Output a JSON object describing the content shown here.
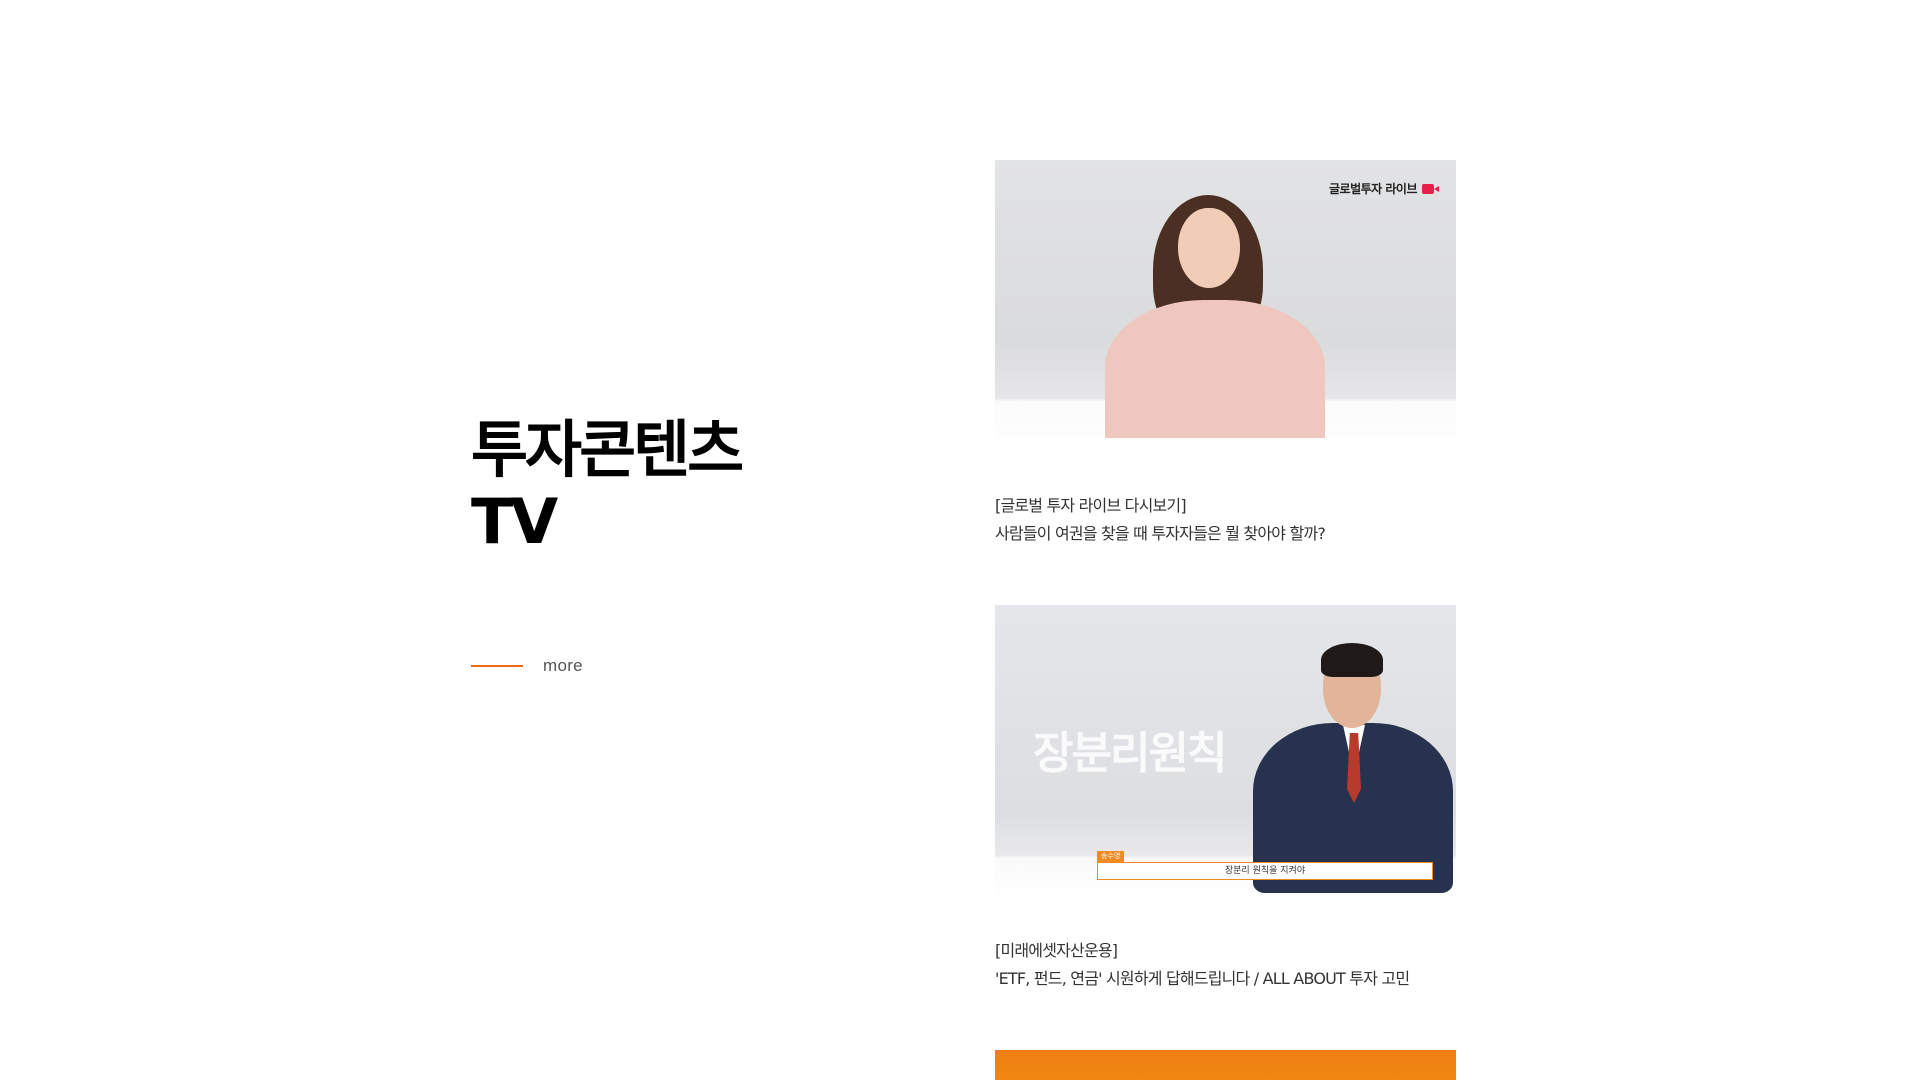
{
  "section": {
    "title_line1": "투자콘텐츠",
    "title_line2": "TV",
    "more_label": "more",
    "accent_color": "#ee6a15"
  },
  "videos": [
    {
      "thumbnail_badge": "글로벌투자 라이브",
      "category": "[글로벌 투자 라이브 다시보기]",
      "title": "사람들이 여권을 찾을 때 투자자들은 뭘 찾아야 할까?"
    },
    {
      "thumbnail_overlay": "장분리원칙",
      "caption_tag": "송수영",
      "caption": "장분리 원칙을 지켜야",
      "category": "[미래에셋자산운용]",
      "title": "'ETF, 펀드, 연금' 시원하게 답해드립니다 / ALL ABOUT 투자 고민"
    },
    {
      "thumbnail_color": "#f08a10"
    }
  ]
}
